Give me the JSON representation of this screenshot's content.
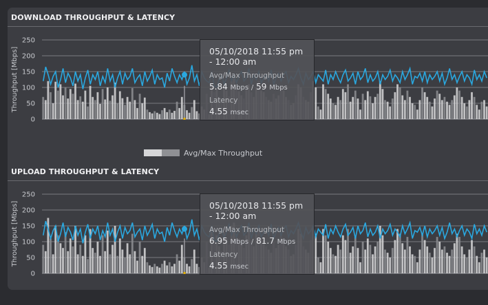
{
  "download": {
    "title": "DOWNLOAD THROUGHPUT & LATENCY",
    "tooltip": {
      "datetime": "05/10/2018 11:55 pm - 12:00 am",
      "throughput_label": "Avg/Max Throughput",
      "avg": "5.84",
      "max": "59",
      "unit": "Mbps",
      "separator": "/",
      "latency_label": "Latency",
      "latency_value": "4.55",
      "latency_unit": "msec"
    }
  },
  "upload": {
    "title": "UPLOAD THROUGHPUT & LATENCY",
    "tooltip": {
      "datetime": "05/10/2018 11:55 pm - 12:00 am",
      "throughput_label": "Avg/Max Throughput",
      "avg": "6.95",
      "max": "81.7",
      "unit": "Mbps",
      "separator": "/",
      "latency_label": "Latency",
      "latency_value": "4.55",
      "latency_unit": "msec"
    }
  },
  "legend": {
    "label": "Avg/Max Throughput"
  },
  "colors": {
    "line": "#2aa8e0",
    "bar_max": "#cfcfd1",
    "bar_avg": "#8a8b8f",
    "marker": "#e5b100",
    "accent": "#2aa8e0"
  },
  "chart_data": [
    {
      "type": "bar",
      "title": "DOWNLOAD THROUGHPUT & LATENCY",
      "ylabel": "Throughput [Mbps]",
      "ylim": [
        0,
        250
      ],
      "yticks": [
        "0",
        "50",
        "100",
        "150",
        "200",
        "250"
      ],
      "grid": true,
      "series": [
        {
          "name": "Avg/Max Throughput",
          "values": [
            70,
            60,
            120,
            85,
            50,
            118,
            90,
            110,
            75,
            100,
            65,
            95,
            80,
            112,
            60,
            72,
            55,
            90,
            40,
            105,
            70,
            60,
            85,
            48,
            95,
            62,
            100,
            58,
            75,
            115,
            50,
            88,
            66,
            45,
            70,
            55,
            98,
            60,
            35,
            80,
            50,
            68,
            30,
            22,
            18,
            25,
            20,
            16,
            28,
            35,
            22,
            30,
            20,
            26,
            55,
            35,
            70,
            45,
            28,
            20,
            38,
            60,
            25,
            18,
            40,
            30,
            80,
            15,
            110,
            85,
            95,
            70,
            60,
            105,
            90,
            72,
            120,
            130,
            100,
            88,
            75,
            65,
            95,
            110,
            85,
            70,
            100,
            120,
            90,
            85,
            70,
            60,
            55,
            80,
            65,
            75,
            100,
            90,
            70,
            60,
            45,
            50,
            75,
            110,
            100,
            70,
            60,
            55,
            85,
            120,
            100,
            40,
            30,
            110,
            95,
            80,
            65,
            50,
            45,
            70,
            60,
            95,
            85,
            110,
            55,
            70,
            90,
            65,
            30,
            80,
            60,
            88,
            72,
            50,
            70,
            80,
            120,
            95,
            60,
            55,
            40,
            65,
            85,
            110,
            100,
            75,
            60,
            90,
            70,
            50,
            45,
            30,
            60,
            100,
            85,
            70,
            55,
            40,
            65,
            90,
            80,
            60,
            70,
            55,
            45,
            60,
            75,
            100,
            90,
            70,
            50,
            40,
            60,
            85,
            70,
            45,
            30,
            55,
            60,
            40
          ]
        },
        {
          "name": "Latency",
          "values": [
            120,
            165,
            140,
            110,
            135,
            150,
            100,
            125,
            160,
            115,
            145,
            130,
            105,
            150,
            120,
            140,
            95,
            130,
            155,
            110,
            140,
            125,
            150,
            105,
            135,
            115,
            160,
            120,
            140,
            100,
            130,
            150,
            110,
            145,
            125,
            135,
            160,
            115,
            130,
            140,
            105,
            150,
            120,
            135,
            155,
            110,
            140,
            125,
            130,
            100,
            145,
            120,
            160,
            135,
            115,
            140,
            125,
            150,
            110,
            130,
            170,
            120,
            140,
            105,
            150,
            130,
            120,
            115,
            150,
            105,
            100,
            125,
            140,
            110,
            130,
            155,
            120,
            140,
            115,
            135,
            150,
            120,
            130,
            160,
            110,
            140,
            125,
            150,
            115,
            130,
            140,
            120,
            155,
            110,
            130,
            145,
            120,
            140,
            150,
            115,
            135,
            125,
            140,
            160,
            130,
            110,
            145,
            125,
            135,
            150,
            115,
            140,
            130,
            120,
            155,
            110,
            140,
            125,
            150,
            130,
            115,
            140,
            155,
            120,
            130,
            145,
            110,
            150,
            125,
            135,
            160,
            115,
            140,
            120,
            130,
            150,
            110,
            140,
            125,
            135,
            155,
            120,
            140,
            130,
            115,
            150,
            125,
            140,
            160,
            110,
            135,
            130,
            145,
            120,
            150,
            115,
            140,
            125,
            135,
            150,
            120,
            145,
            110,
            130,
            160,
            125,
            140,
            115,
            135,
            150,
            120,
            140,
            130,
            110,
            155,
            125,
            140,
            120,
            150,
            130
          ]
        }
      ]
    },
    {
      "type": "bar",
      "title": "UPLOAD THROUGHPUT & LATENCY",
      "ylabel": "Throughput [Mbps]",
      "ylim": [
        0,
        250
      ],
      "yticks": [
        "0",
        "50",
        "100",
        "150",
        "200",
        "250"
      ],
      "grid": true,
      "series": [
        {
          "name": "Avg/Max Throughput",
          "values": [
            90,
            70,
            175,
            110,
            60,
            150,
            120,
            95,
            80,
            130,
            70,
            110,
            85,
            150,
            60,
            90,
            55,
            120,
            45,
            140,
            80,
            65,
            100,
            55,
            120,
            70,
            135,
            60,
            90,
            150,
            55,
            110,
            75,
            50,
            95,
            60,
            125,
            70,
            40,
            100,
            55,
            80,
            35,
            25,
            20,
            30,
            22,
            18,
            30,
            40,
            25,
            35,
            22,
            30,
            60,
            40,
            90,
            50,
            30,
            22,
            45,
            75,
            30,
            20,
            50,
            35,
            100,
            18,
            140,
            100,
            120,
            85,
            70,
            130,
            110,
            90,
            150,
            160,
            125,
            110,
            95,
            80,
            120,
            140,
            105,
            85,
            125,
            150,
            110,
            105,
            85,
            75,
            65,
            100,
            80,
            90,
            125,
            110,
            85,
            75,
            55,
            60,
            90,
            140,
            125,
            85,
            75,
            65,
            105,
            150,
            125,
            50,
            35,
            140,
            120,
            100,
            80,
            60,
            55,
            90,
            75,
            120,
            105,
            140,
            65,
            85,
            115,
            80,
            35,
            100,
            75,
            110,
            90,
            60,
            85,
            100,
            150,
            120,
            75,
            65,
            50,
            80,
            105,
            140,
            125,
            95,
            75,
            115,
            85,
            60,
            55,
            35,
            75,
            125,
            105,
            85,
            65,
            50,
            80,
            115,
            100,
            75,
            85,
            65,
            55,
            75,
            95,
            125,
            115,
            85,
            60,
            50,
            75,
            105,
            85,
            55,
            35,
            65,
            75,
            50
          ]
        },
        {
          "name": "Latency",
          "values": [
            120,
            165,
            140,
            110,
            135,
            150,
            100,
            125,
            160,
            115,
            145,
            130,
            105,
            150,
            120,
            140,
            95,
            130,
            155,
            110,
            140,
            125,
            150,
            105,
            135,
            115,
            160,
            120,
            140,
            100,
            130,
            150,
            110,
            145,
            125,
            135,
            160,
            115,
            130,
            140,
            105,
            150,
            120,
            135,
            155,
            110,
            140,
            125,
            130,
            100,
            145,
            120,
            160,
            135,
            115,
            140,
            125,
            150,
            110,
            130,
            170,
            120,
            140,
            105,
            150,
            130,
            120,
            115,
            150,
            105,
            100,
            125,
            140,
            110,
            130,
            155,
            120,
            140,
            115,
            135,
            150,
            120,
            130,
            160,
            110,
            140,
            125,
            150,
            115,
            130,
            140,
            120,
            155,
            110,
            130,
            145,
            120,
            140,
            150,
            115,
            135,
            125,
            140,
            160,
            130,
            110,
            145,
            125,
            135,
            150,
            115,
            140,
            130,
            120,
            155,
            110,
            140,
            125,
            150,
            130,
            115,
            140,
            155,
            120,
            130,
            145,
            110,
            150,
            125,
            135,
            160,
            115,
            140,
            120,
            130,
            150,
            110,
            140,
            125,
            135,
            155,
            120,
            140,
            130,
            115,
            150,
            125,
            140,
            160,
            110,
            135,
            130,
            145,
            120,
            150,
            115,
            140,
            125,
            135,
            150,
            120,
            145,
            110,
            130,
            160,
            125,
            140,
            115,
            135,
            150,
            120,
            140,
            130,
            110,
            155,
            125,
            140,
            120,
            150,
            130
          ]
        }
      ]
    }
  ]
}
